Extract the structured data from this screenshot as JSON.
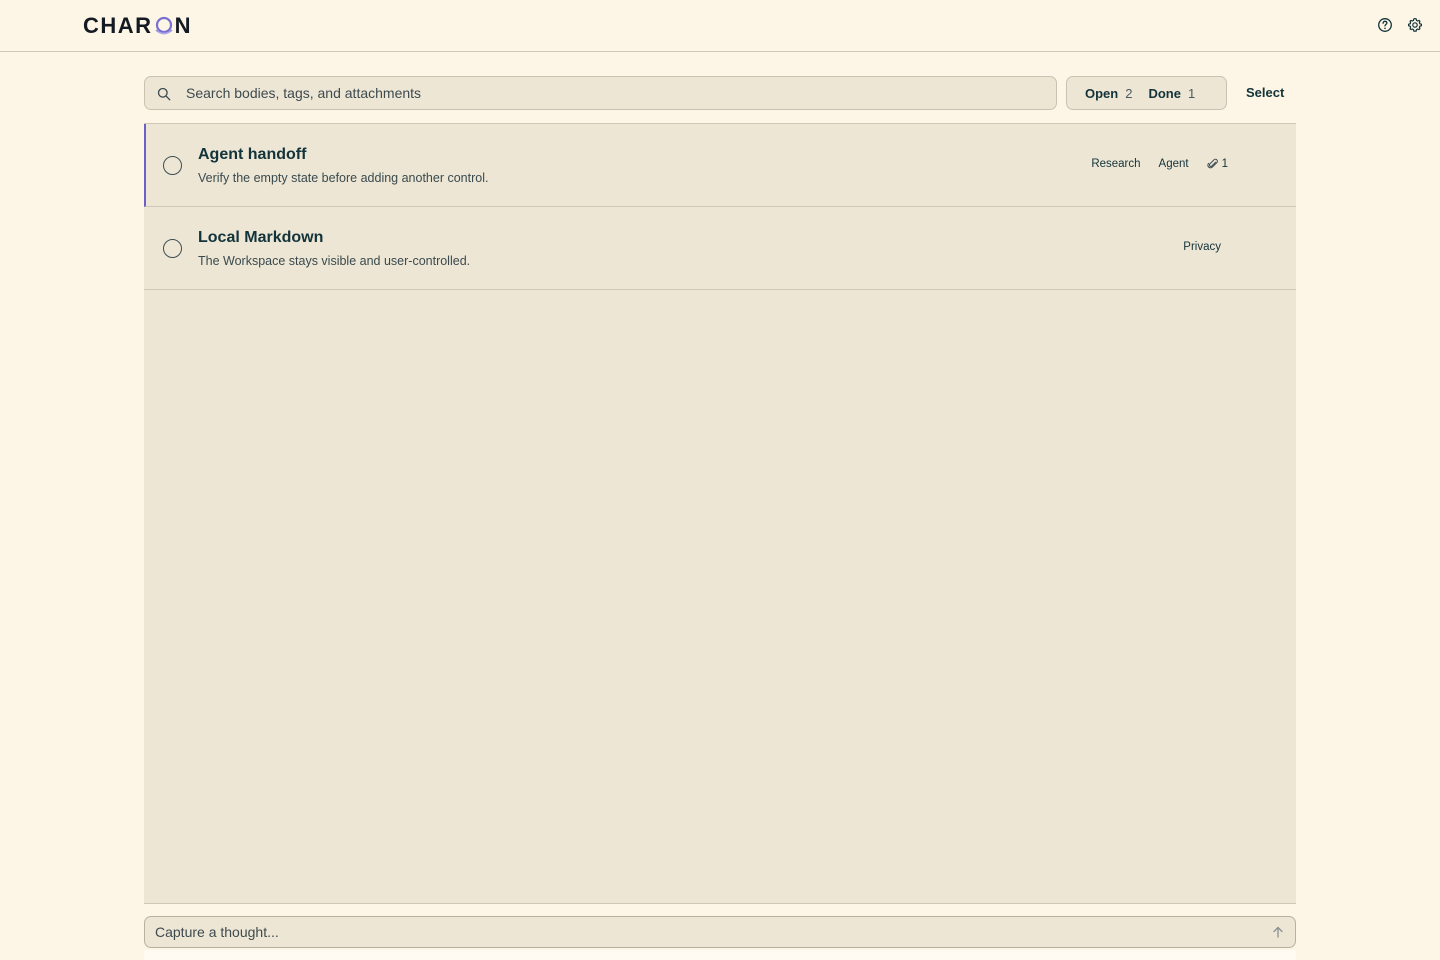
{
  "header": {
    "logo_left": "CHAR",
    "logo_right": "N",
    "help_icon": "question-circle-icon",
    "settings_icon": "gear-icon"
  },
  "search": {
    "placeholder": "Search bodies, tags, and attachments",
    "icon": "search-icon"
  },
  "filters": {
    "open_label": "Open",
    "open_count": "2",
    "done_label": "Done",
    "done_count": "1"
  },
  "select_label": "Select",
  "items": [
    {
      "title": "Agent handoff",
      "body": "Verify the empty state before adding another control.",
      "tags": [
        "Research",
        "Agent"
      ],
      "attachments": "1",
      "active": true
    },
    {
      "title": "Local Markdown",
      "body": "The Workspace stays visible and user-controlled.",
      "tags": [
        "Privacy"
      ],
      "active": false
    }
  ],
  "capture": {
    "placeholder": "Capture a thought...",
    "send_icon": "arrow-up-icon"
  },
  "colors": {
    "background": "#fdf5e6",
    "panel": "#ede6d5",
    "text": "#13333a",
    "accent": "#6c5fc7"
  }
}
